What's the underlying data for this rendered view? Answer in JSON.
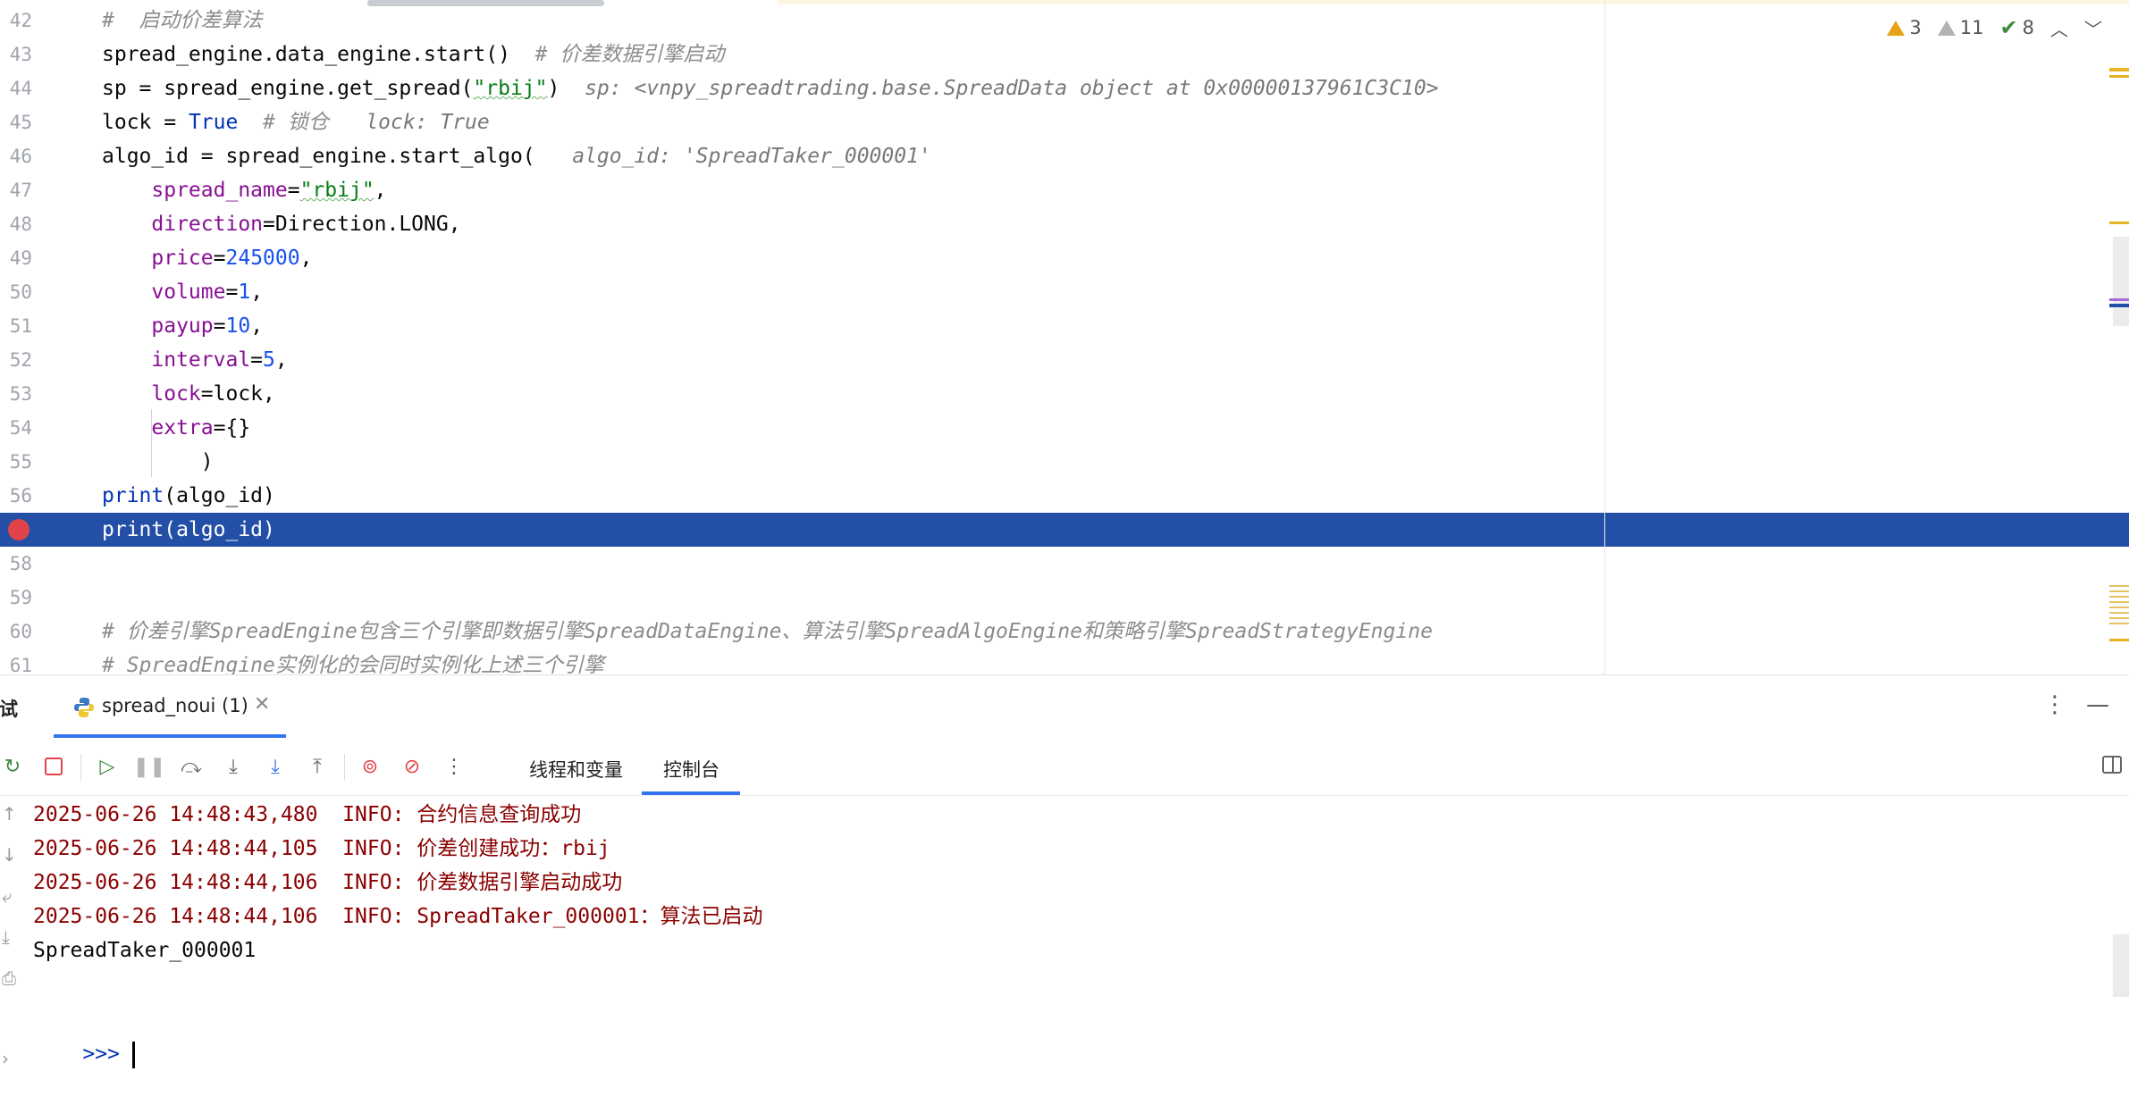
{
  "editor": {
    "lines": [
      {
        "num": "42",
        "html_parts": [
          {
            "t": "#  启动价差算法",
            "c": "cm"
          }
        ]
      },
      {
        "num": "43",
        "html_parts": [
          {
            "t": "spread_engine.data_engine.start()  ",
            "c": "fn"
          },
          {
            "t": "# 价差数据引擎启动",
            "c": "cm"
          }
        ]
      },
      {
        "num": "44",
        "html_parts": [
          {
            "t": "sp = spread_engine.get_spread(",
            "c": "fn"
          },
          {
            "t": "\"rbij\"",
            "c": "str sq"
          },
          {
            "t": ")  ",
            "c": "fn"
          },
          {
            "t": "sp: <vnpy_spreadtrading.base.SpreadData object at 0x00000137961C3C10>",
            "c": "inlay"
          }
        ]
      },
      {
        "num": "45",
        "html_parts": [
          {
            "t": "lock = ",
            "c": "fn"
          },
          {
            "t": "True",
            "c": "kw"
          },
          {
            "t": "  ",
            "c": "fn"
          },
          {
            "t": "# 锁仓",
            "c": "cm"
          },
          {
            "t": "   lock: True",
            "c": "inlay"
          }
        ]
      },
      {
        "num": "46",
        "html_parts": [
          {
            "t": "algo_id = spread_engine.start_algo(   ",
            "c": "fn"
          },
          {
            "t": "algo_id: 'SpreadTaker_000001'",
            "c": "inlay"
          }
        ]
      },
      {
        "num": "47",
        "html_parts": [
          {
            "t": "    ",
            "c": "fn"
          },
          {
            "t": "spread_name",
            "c": "param"
          },
          {
            "t": "=",
            "c": "fn"
          },
          {
            "t": "\"rbij\"",
            "c": "str sq"
          },
          {
            "t": ",",
            "c": "fn"
          }
        ]
      },
      {
        "num": "48",
        "html_parts": [
          {
            "t": "    ",
            "c": "fn"
          },
          {
            "t": "direction",
            "c": "param"
          },
          {
            "t": "=Direction.LONG,",
            "c": "fn"
          }
        ]
      },
      {
        "num": "49",
        "html_parts": [
          {
            "t": "    ",
            "c": "fn"
          },
          {
            "t": "price",
            "c": "param"
          },
          {
            "t": "=",
            "c": "fn"
          },
          {
            "t": "245000",
            "c": "num"
          },
          {
            "t": ",",
            "c": "fn"
          }
        ]
      },
      {
        "num": "50",
        "html_parts": [
          {
            "t": "    ",
            "c": "fn"
          },
          {
            "t": "volume",
            "c": "param"
          },
          {
            "t": "=",
            "c": "fn"
          },
          {
            "t": "1",
            "c": "num"
          },
          {
            "t": ",",
            "c": "fn"
          }
        ]
      },
      {
        "num": "51",
        "html_parts": [
          {
            "t": "    ",
            "c": "fn"
          },
          {
            "t": "payup",
            "c": "param"
          },
          {
            "t": "=",
            "c": "fn"
          },
          {
            "t": "10",
            "c": "num"
          },
          {
            "t": ",",
            "c": "fn"
          }
        ]
      },
      {
        "num": "52",
        "html_parts": [
          {
            "t": "    ",
            "c": "fn"
          },
          {
            "t": "interval",
            "c": "param"
          },
          {
            "t": "=",
            "c": "fn"
          },
          {
            "t": "5",
            "c": "num"
          },
          {
            "t": ",",
            "c": "fn"
          }
        ]
      },
      {
        "num": "53",
        "html_parts": [
          {
            "t": "    ",
            "c": "fn"
          },
          {
            "t": "lock",
            "c": "param"
          },
          {
            "t": "=lock,",
            "c": "fn"
          }
        ]
      },
      {
        "num": "54",
        "html_parts": [
          {
            "t": "    ",
            "c": "fn"
          },
          {
            "t": "extra",
            "c": "param"
          },
          {
            "t": "={}",
            "c": "fn"
          }
        ]
      },
      {
        "num": "55",
        "html_parts": [
          {
            "t": "        )",
            "c": "fn"
          }
        ]
      },
      {
        "num": "56",
        "html_parts": [
          {
            "t": "print",
            "c": "kw"
          },
          {
            "t": "(algo_id)",
            "c": "fn"
          }
        ]
      },
      {
        "num": "",
        "breakpoint": true,
        "highlight": true,
        "html_parts": [
          {
            "t": "print(algo_id)",
            "c": "fn"
          }
        ]
      },
      {
        "num": "58",
        "html_parts": []
      },
      {
        "num": "59",
        "html_parts": []
      },
      {
        "num": "60",
        "html_parts": [
          {
            "t": "# 价差引擎SpreadEngine包含三个引擎即数据引擎SpreadDataEngine、算法引擎SpreadAlgoEngine和策略引擎SpreadStrategyEngine",
            "c": "cm"
          }
        ]
      },
      {
        "num": "61",
        "html_parts": [
          {
            "t": "# SpreadEngine实例化的会同时实例化上述三个引擎",
            "c": "cm"
          }
        ]
      }
    ],
    "inspections": {
      "warnings": "3",
      "weak_warnings": "11",
      "typos": "8"
    }
  },
  "tool_window": {
    "title": "调试",
    "run_tab_label": "spread_noui (1)",
    "view_tabs": [
      "线程和变量",
      "控制台"
    ]
  },
  "console": {
    "lines": [
      {
        "text": "2025-06-26 14:48:43,480  INFO: 合约信息查询成功",
        "kind": "log"
      },
      {
        "text": "2025-06-26 14:48:44,105  INFO: 价差创建成功：rbij",
        "kind": "log"
      },
      {
        "text": "2025-06-26 14:48:44,106  INFO: 价差数据引擎启动成功",
        "kind": "log"
      },
      {
        "text": "2025-06-26 14:48:44,106  INFO: SpreadTaker_000001：算法已启动",
        "kind": "log"
      },
      {
        "text": "SpreadTaker_000001",
        "kind": "out"
      }
    ],
    "prompt": ">>>"
  },
  "colors": {
    "selection": "#2350a6",
    "accent": "#3574f0",
    "log": "#8b0000",
    "breakpoint": "#e2434b"
  }
}
